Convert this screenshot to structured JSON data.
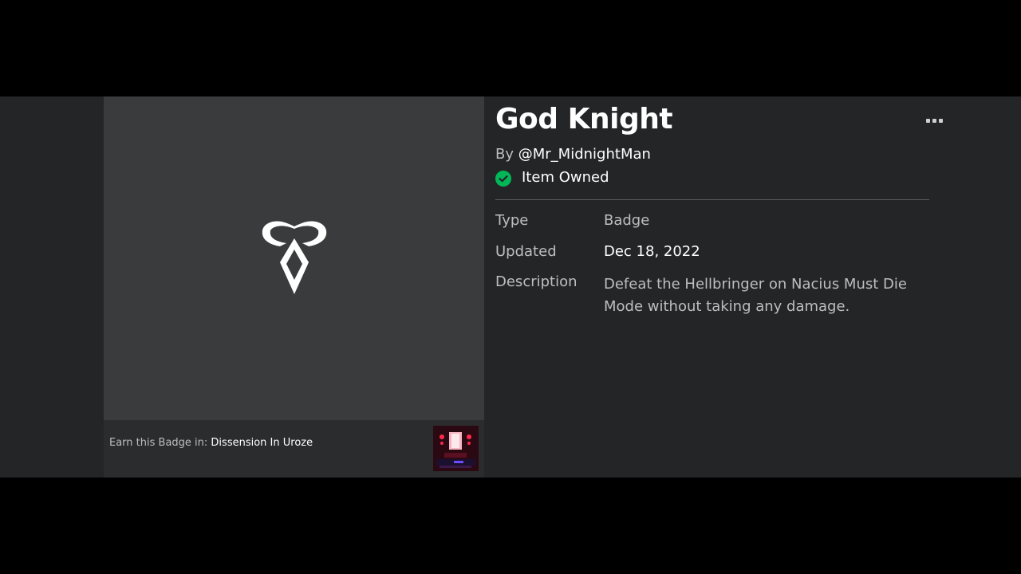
{
  "badge": {
    "title": "God Knight",
    "by_prefix": "By",
    "creator": "@Mr_MidnightMan",
    "owned_text": "Item Owned",
    "icon": "badge-rune-icon"
  },
  "details": {
    "type_label": "Type",
    "type_value": "Badge",
    "updated_label": "Updated",
    "updated_value": "Dec 18, 2022",
    "description_label": "Description",
    "description_value": "Defeat the Hellbringer on Nacius Must Die Mode without taking any damage."
  },
  "earn": {
    "prefix": "Earn this Badge in:",
    "game_name": "Dissension In Uroze"
  },
  "colors": {
    "page_bg": "#232527",
    "thumb_bg": "#393b3d",
    "owned_green": "#02b757",
    "text_muted": "#bdbebe",
    "text_primary": "#ffffff"
  }
}
